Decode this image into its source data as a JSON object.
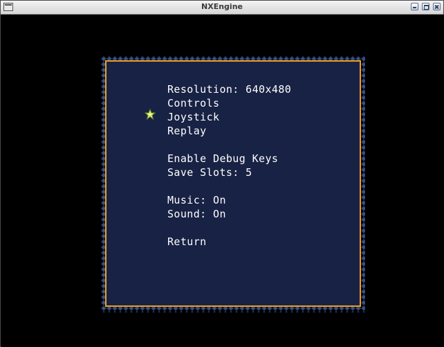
{
  "window": {
    "title": "NXEngine",
    "buttons": [
      "minimize",
      "maximize",
      "close"
    ]
  },
  "menu": {
    "items": [
      {
        "label": "Resolution: 640x480"
      },
      {
        "label": "Controls"
      },
      {
        "label": "Joystick"
      },
      {
        "label": "Replay"
      },
      {
        "label": "Enable Debug Keys"
      },
      {
        "label": "Save Slots: 5"
      },
      {
        "label": "Music: On"
      },
      {
        "label": "Sound: On"
      },
      {
        "label": "Return"
      }
    ],
    "selected_label": "Joystick",
    "cursor_icon": "star-cursor-icon"
  },
  "colors": {
    "background": "#000000",
    "panel_fill": "#182244",
    "panel_border": "#f0a020",
    "panel_zigzag": "#2c3f6e",
    "text": "#ffffff",
    "cursor": "#d8f070"
  }
}
